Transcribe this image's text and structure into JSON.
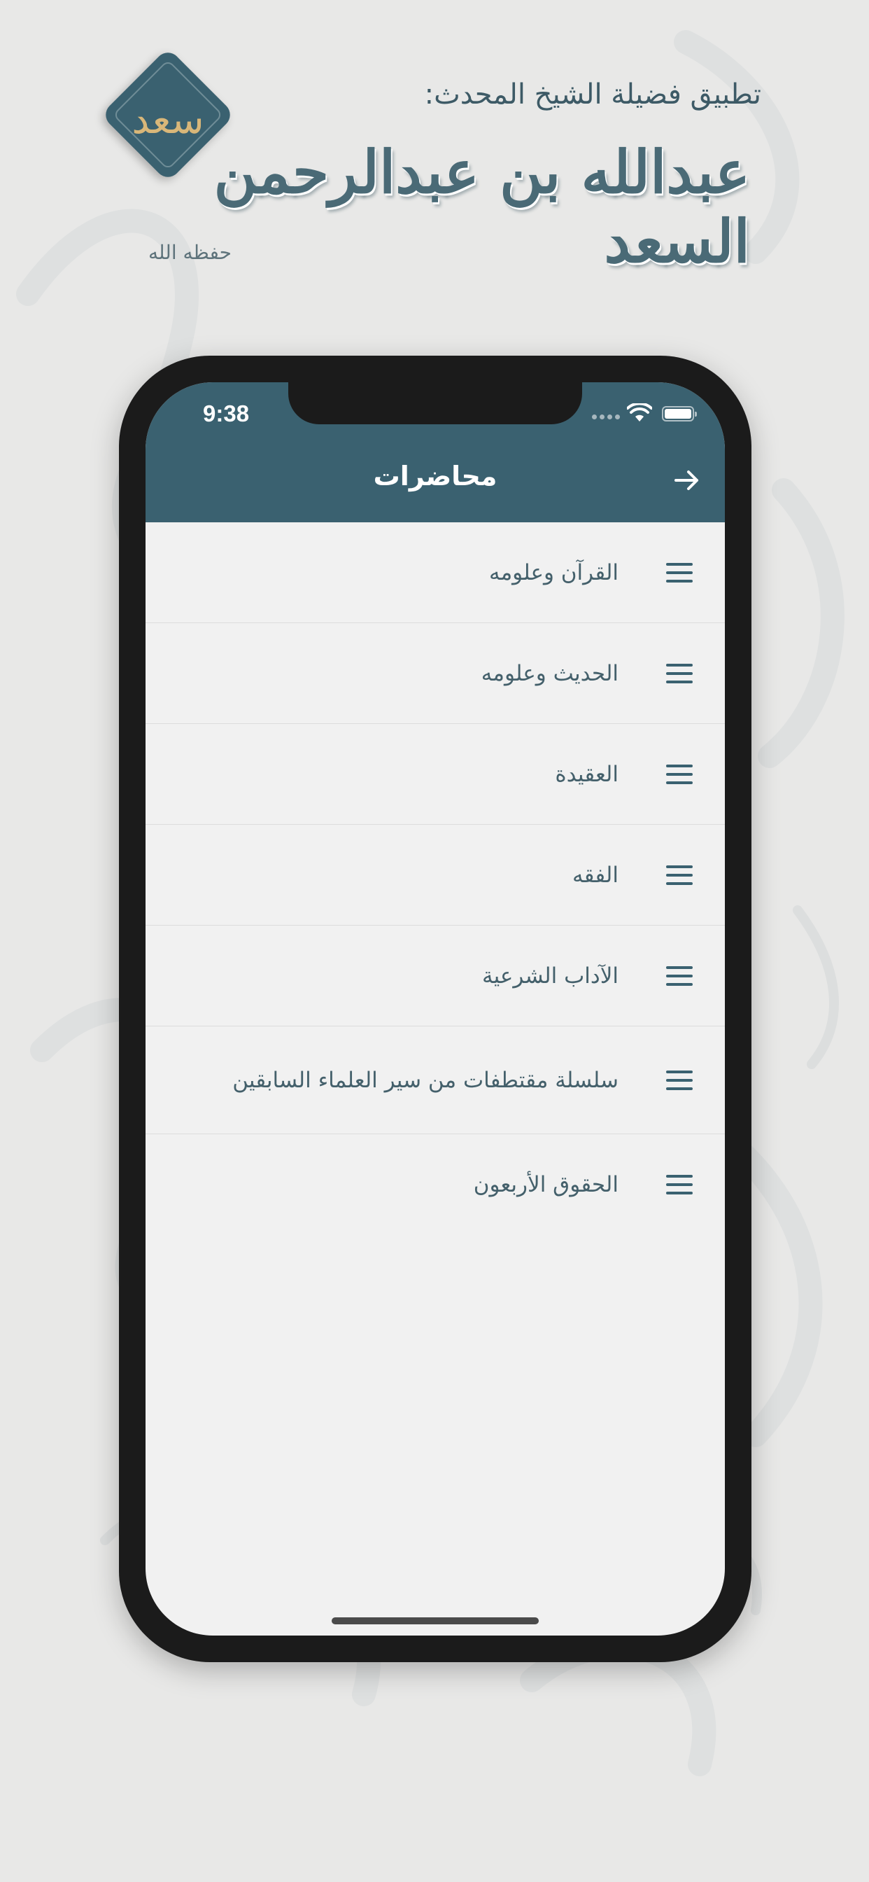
{
  "promo": {
    "subtitle": "تطبيق فضيلة الشيخ المحدث:",
    "name": "عبدالله بن عبدالرحمن السعد",
    "honorific": "حفظه الله",
    "logo_mark": "سعد",
    "accent_color": "#3a6170"
  },
  "status_bar": {
    "time": "9:38"
  },
  "nav": {
    "title": "محاضرات",
    "back_icon": "arrow-right-icon"
  },
  "list": {
    "items": [
      {
        "label": "القرآن وعلومه",
        "icon": "menu-icon"
      },
      {
        "label": "الحديث وعلومه",
        "icon": "menu-icon"
      },
      {
        "label": "العقيدة",
        "icon": "menu-icon"
      },
      {
        "label": "الفقه",
        "icon": "menu-icon"
      },
      {
        "label": "الآداب الشرعية",
        "icon": "menu-icon"
      },
      {
        "label": "سلسلة مقتطفات من سير العلماء السابقين",
        "icon": "menu-icon"
      },
      {
        "label": "الحقوق الأربعون",
        "icon": "menu-icon"
      }
    ]
  }
}
